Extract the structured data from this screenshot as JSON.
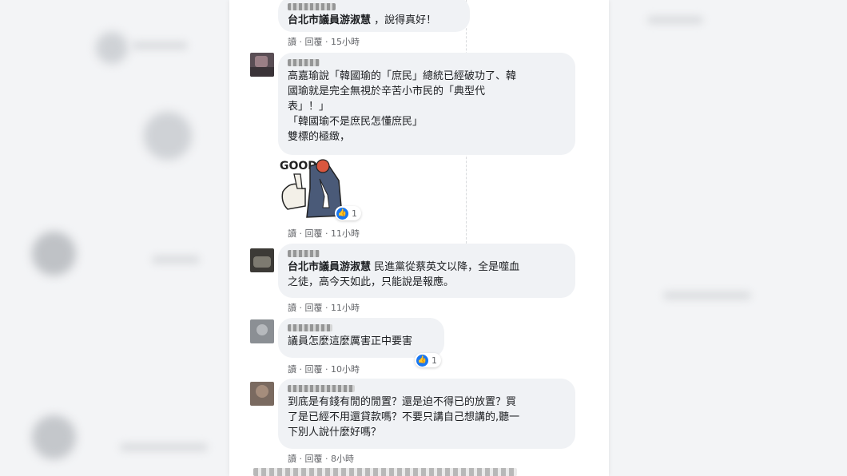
{
  "comments": [
    {
      "tag": "台北市議員游淑慧",
      "text": " ，說得真好！",
      "actions": [
        "讀",
        "回覆"
      ],
      "time": "15小時"
    },
    {
      "lines": [
        "高嘉瑜說「韓國瑜的「庶民」總統已經破功了、韓",
        "國瑜就是完全無視於辛苦小市民的「典型代",
        "表」！」",
        "「韓國瑜不是庶民怎懂庶民」",
        "雙標的極緻，"
      ],
      "sticker_text": "GOOD",
      "likes": "1",
      "actions": [
        "讀",
        "回覆"
      ],
      "time": "11小時"
    },
    {
      "tag": "台北市議員游淑慧",
      "lines": [
        " 民進黨從蔡英文以降，全是噬血",
        "之徒，高今天如此，只能說是報應。"
      ],
      "actions": [
        "讀",
        "回覆"
      ],
      "time": "11小時"
    },
    {
      "lines": [
        "議員怎麼這麼厲害正中要害"
      ],
      "likes": "1",
      "actions": [
        "讀",
        "回覆"
      ],
      "time": "10小時"
    },
    {
      "lines": [
        "到底是有錢有閒的閒置？還是迫不得已的放置？買",
        "了是已經不用還貸款嗎？不要只講自己想講的,聽一",
        "下別人說什麼好嗎？"
      ],
      "actions": [
        "讀",
        "回覆"
      ],
      "time": "8小時"
    }
  ],
  "colors": {
    "bubble": "#f0f2f5",
    "meta": "#65676b",
    "like": "#1877f2"
  }
}
